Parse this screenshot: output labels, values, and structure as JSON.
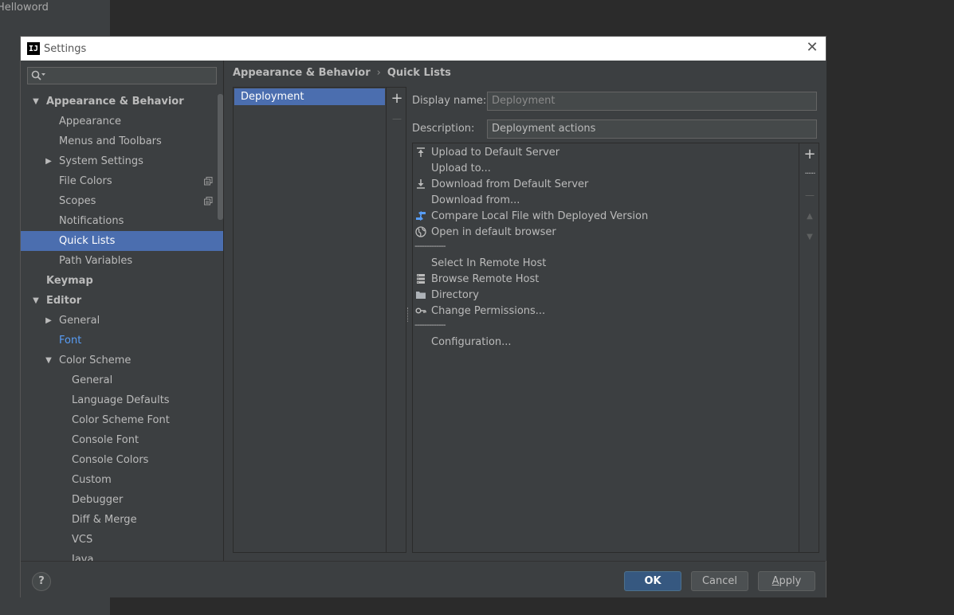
{
  "background": {
    "project_name": "Helloword"
  },
  "dialog": {
    "title": "Settings",
    "app_icon_text": "IJ"
  },
  "sidebar": {
    "search_placeholder": "",
    "items": [
      {
        "label": "Appearance & Behavior"
      },
      {
        "label": "Appearance"
      },
      {
        "label": "Menus and Toolbars"
      },
      {
        "label": "System Settings"
      },
      {
        "label": "File Colors"
      },
      {
        "label": "Scopes"
      },
      {
        "label": "Notifications"
      },
      {
        "label": "Quick Lists"
      },
      {
        "label": "Path Variables"
      },
      {
        "label": "Keymap"
      },
      {
        "label": "Editor"
      },
      {
        "label": "General"
      },
      {
        "label": "Font"
      },
      {
        "label": "Color Scheme"
      },
      {
        "label": "General"
      },
      {
        "label": "Language Defaults"
      },
      {
        "label": "Color Scheme Font"
      },
      {
        "label": "Console Font"
      },
      {
        "label": "Console Colors"
      },
      {
        "label": "Custom"
      },
      {
        "label": "Debugger"
      },
      {
        "label": "Diff & Merge"
      },
      {
        "label": "VCS"
      },
      {
        "label": "Java"
      }
    ]
  },
  "breadcrumb": {
    "parent": "Appearance & Behavior",
    "separator": "›",
    "current": "Quick Lists"
  },
  "quick_lists": {
    "items": [
      "Deployment"
    ],
    "add_label": "+",
    "remove_label": "—"
  },
  "form": {
    "display_name_label": "Display name:",
    "display_name_value": "Deployment",
    "description_label": "Description:",
    "description_value": "Deployment actions"
  },
  "actions": {
    "items": [
      {
        "label": "Upload to Default Server",
        "icon": "upload-icon"
      },
      {
        "label": "Upload to...",
        "icon": ""
      },
      {
        "label": "Download from Default Server",
        "icon": "download-icon"
      },
      {
        "label": "Download from...",
        "icon": ""
      },
      {
        "label": "Compare Local File with Deployed Version",
        "icon": "compare-icon"
      },
      {
        "label": "Open in default browser",
        "icon": "globe-icon"
      },
      {
        "separator": "-------------"
      },
      {
        "label": "Select In Remote Host",
        "icon": ""
      },
      {
        "label": "Browse Remote Host",
        "icon": "server-icon"
      },
      {
        "label": "Directory",
        "icon": "folder-icon"
      },
      {
        "label": "Change Permissions...",
        "icon": "key-icon"
      },
      {
        "separator": "-------------"
      },
      {
        "label": "Configuration...",
        "icon": ""
      }
    ],
    "tools": {
      "add": "+",
      "add_separator": "......",
      "remove": "—",
      "move_up": "▲",
      "move_down": "▼"
    }
  },
  "footer": {
    "help": "?",
    "ok": "OK",
    "cancel": "Cancel",
    "apply_underlined": "A",
    "apply_rest": "pply"
  },
  "colors": {
    "selection": "#4b6eaf",
    "link": "#589df6",
    "ok_button": "#365880",
    "panel_bg": "#3c3f41"
  }
}
